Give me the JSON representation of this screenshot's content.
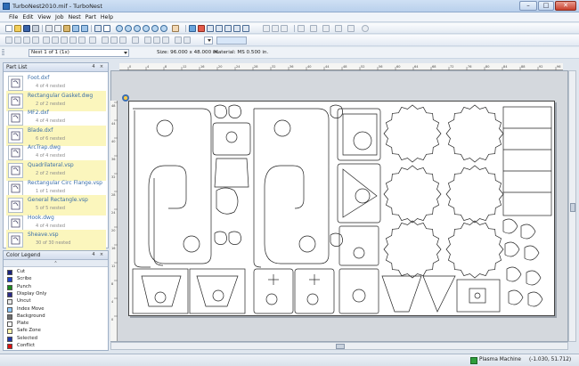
{
  "window": {
    "title": "TurboNest2010.mif - TurboNest",
    "min": "–",
    "max": "□",
    "close": "✕"
  },
  "menu": [
    "File",
    "Edit",
    "View",
    "Job",
    "Nest",
    "Part",
    "Help"
  ],
  "toolbar3": {
    "nest_select": "Nest 1 of 1 (1x)",
    "sheet_size": "Size: 96.000 x 48.000 in.",
    "material": "Material: MS 0.500 in."
  },
  "part_list": {
    "title": "Part List",
    "pin": "4",
    "close": "×",
    "items": [
      {
        "name": "Foot.dxf",
        "nested": "4 of 4 nested",
        "icon": "foot-part-icon"
      },
      {
        "name": "Rectangular Gasket.dwg",
        "nested": "2 of 2 nested",
        "icon": "gasket-part-icon"
      },
      {
        "name": "MF2.dxf",
        "nested": "4 of 4 nested",
        "icon": "mf2-part-icon"
      },
      {
        "name": "Blade.dxf",
        "nested": "6 of 6 nested",
        "icon": "blade-part-icon"
      },
      {
        "name": "ArcTrap.dwg",
        "nested": "4 of 4 nested",
        "icon": "arctrap-part-icon"
      },
      {
        "name": "Quadrilateral.vsp",
        "nested": "2 of 2 nested",
        "icon": "quad-part-icon"
      },
      {
        "name": "Rectangular Circ Flange.vsp",
        "nested": "1 of 1 nested",
        "icon": "flange-part-icon"
      },
      {
        "name": "General Rectangle.vsp",
        "nested": "5 of 5 nested",
        "icon": "rectangle-part-icon"
      },
      {
        "name": "Hook.dwg",
        "nested": "4 of 4 nested",
        "icon": "hook-part-icon"
      },
      {
        "name": "Sheave.vsp",
        "nested": "30 of 30 nested",
        "icon": "sheave-part-icon"
      }
    ]
  },
  "color_legend": {
    "title": "Color Legend",
    "pin": "4",
    "close": "×",
    "collapse": "⌃",
    "items": [
      {
        "label": "Cut",
        "color": "#1a237e"
      },
      {
        "label": "Scribe",
        "color": "#1e40c8"
      },
      {
        "label": "Punch",
        "color": "#1b8a1b"
      },
      {
        "label": "Display Only",
        "color": "#2a2a8a"
      },
      {
        "label": "Uncut",
        "color": "#e8e8e8"
      },
      {
        "label": "Index Move",
        "color": "#8cc8ff"
      },
      {
        "label": "Background",
        "color": "#6e6e6e"
      },
      {
        "label": "Plate",
        "color": "#ffffff"
      },
      {
        "label": "Safe Zone",
        "color": "#fff7b0"
      },
      {
        "label": "Selected",
        "color": "#2038a8"
      },
      {
        "label": "Conflict",
        "color": "#e01010"
      }
    ]
  },
  "rulers": {
    "h": [
      "0",
      "4",
      "8",
      "12",
      "16",
      "20",
      "24",
      "28",
      "32",
      "36",
      "40",
      "44",
      "48",
      "52",
      "56",
      "60",
      "64",
      "68",
      "72",
      "76",
      "80",
      "84",
      "88",
      "92",
      "96"
    ],
    "v": [
      "48",
      "44",
      "40",
      "36",
      "32",
      "28",
      "24",
      "20",
      "16",
      "12",
      "8",
      "4",
      "0"
    ]
  },
  "status": {
    "machine": "Plasma Machine",
    "coords": "(-1.030, 51.712)"
  },
  "colors": {
    "accent": "#3a6ea8",
    "highlight_row": "#fbf6bd",
    "sheet": "#ffffff",
    "workspace": "#d4d8dd"
  }
}
